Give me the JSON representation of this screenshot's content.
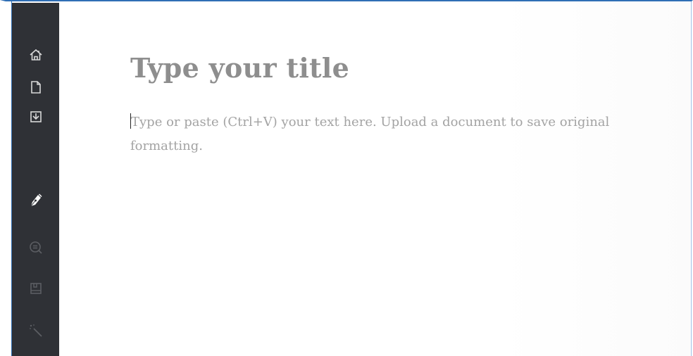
{
  "sidebar": {
    "items": [
      {
        "icon": "home-icon",
        "state": "normal"
      },
      {
        "icon": "new-document-icon",
        "state": "normal"
      },
      {
        "icon": "download-icon",
        "state": "normal"
      },
      {
        "icon": "pen-icon",
        "state": "active"
      },
      {
        "icon": "search-review-icon",
        "state": "dimmed"
      },
      {
        "icon": "book-icon",
        "state": "dimmed"
      },
      {
        "icon": "magic-wand-icon",
        "state": "dimmed"
      }
    ]
  },
  "editor": {
    "title_placeholder": "Type your title",
    "body_placeholder": "Type or paste (Ctrl+V) your text here. Upload a document to save original formatting."
  },
  "colors": {
    "sidebar_bg": "#2f3136",
    "accent_border": "#2f6fb5",
    "title_text": "#8e8e8e",
    "body_text": "#a3a3a3"
  }
}
